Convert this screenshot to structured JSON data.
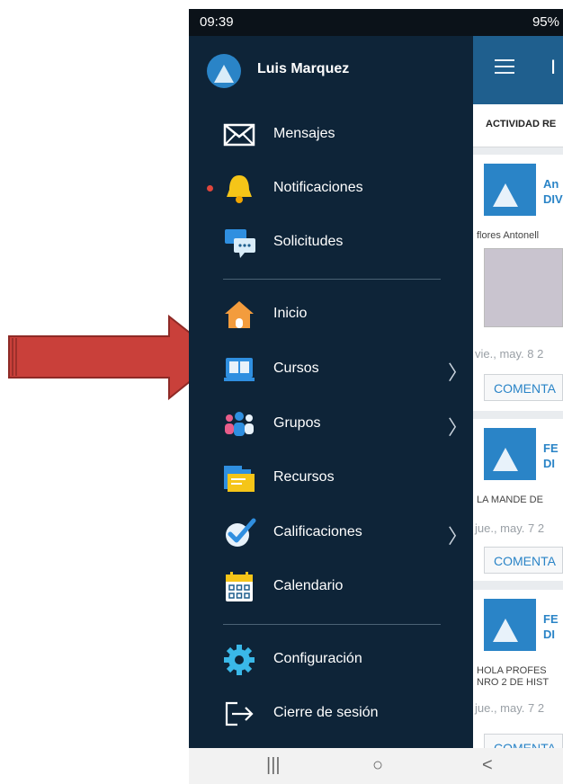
{
  "status_bar": {
    "time": "09:39",
    "battery": "95%"
  },
  "user": {
    "name": "Luis Marquez"
  },
  "menu": {
    "top_items": [
      {
        "label": "Mensajes",
        "icon": "envelope-icon"
      },
      {
        "label": "Notificaciones",
        "icon": "bell-icon",
        "has_dot": true
      },
      {
        "label": "Solicitudes",
        "icon": "chat-bubbles-icon"
      }
    ],
    "main_items": [
      {
        "label": "Inicio",
        "icon": "home-icon"
      },
      {
        "label": "Cursos",
        "icon": "book-icon",
        "has_chevron": true
      },
      {
        "label": "Grupos",
        "icon": "people-icon",
        "has_chevron": true
      },
      {
        "label": "Recursos",
        "icon": "folder-icon"
      },
      {
        "label": "Calificaciones",
        "icon": "check-badge-icon",
        "has_chevron": true
      },
      {
        "label": "Calendario",
        "icon": "calendar-icon"
      }
    ],
    "bottom_items": [
      {
        "label": "Configuración",
        "icon": "gear-icon"
      },
      {
        "label": "Cierre de sesión",
        "icon": "logout-icon"
      }
    ]
  },
  "background_app": {
    "title": "I",
    "tab": "ACTIVIDAD RE",
    "cards": [
      {
        "author": "An\nDIV",
        "text": "flores Antonell",
        "date": "vie., may. 8 2",
        "button": "COMENTA"
      },
      {
        "author": "FE\nDI",
        "text": "LA MANDE DE",
        "date": "jue., may. 7 2",
        "button": "COMENTA"
      },
      {
        "author": "FE\nDI",
        "text": "HOLA PROFES\nNRO 2 DE HIST",
        "date": "jue., may. 7 2",
        "button": "COMENTA"
      }
    ]
  },
  "annotation": {
    "arrow_color": "#c9403a",
    "points_to": "Cursos"
  },
  "colors": {
    "drawer_bg": "#0e2438",
    "accent": "#2a84c7",
    "notification_dot": "#e0463c"
  }
}
